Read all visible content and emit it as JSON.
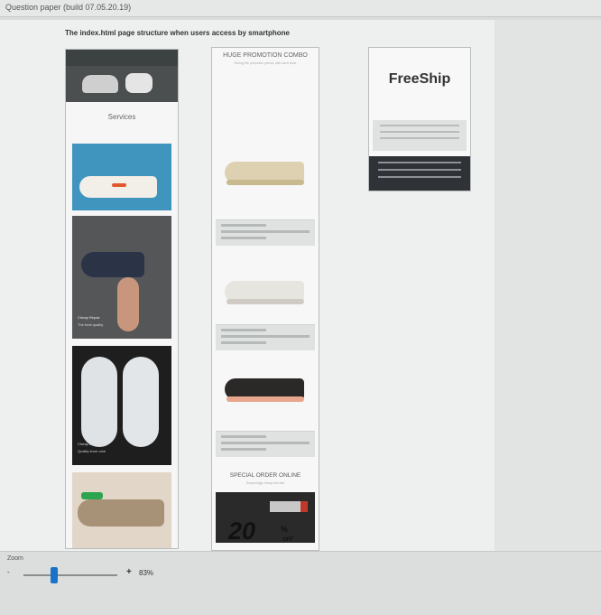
{
  "window": {
    "title": "Question paper (build 07.05.20.19)"
  },
  "page": {
    "heading": "The index.html page structure when users access by smartphone"
  },
  "column1": {
    "services_label": "Services",
    "tile2_caption": "Cheap Repair",
    "tile2_sub": "The best quality",
    "tile3_caption": "Cheap shoe care",
    "tile3_sub": "Quality shoe care"
  },
  "column2": {
    "promo_title": "HUGE PROMOTION COMBO",
    "promo_sub": "During the promotion period, with each shoe",
    "special_title": "SPECIAL ORDER ONLINE",
    "special_sub": "Surprisingly cheap and fast",
    "discount_value": "20",
    "discount_percent": "%",
    "discount_off": "OFF"
  },
  "column3": {
    "brand": "FreeShip"
  },
  "zoom": {
    "label": "Zoom",
    "minus": "-",
    "plus": "+",
    "value": "83%",
    "level": 0.33
  }
}
